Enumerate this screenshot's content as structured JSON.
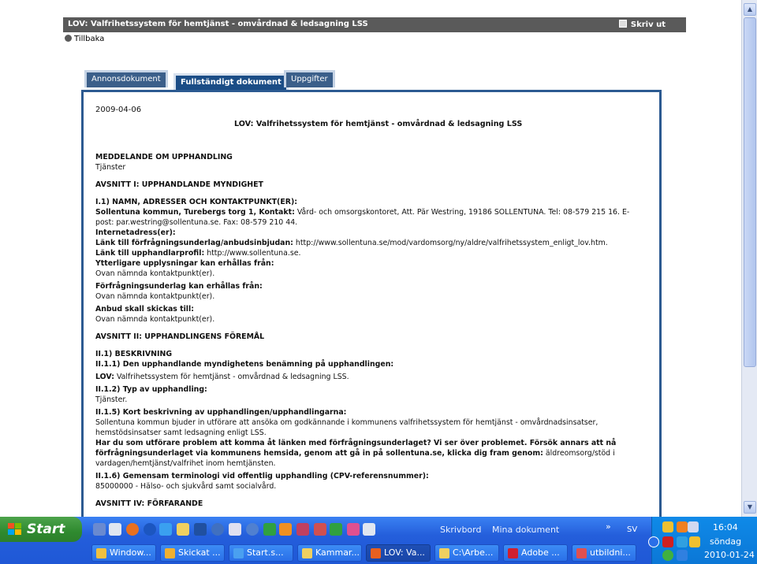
{
  "header": {
    "title": "LOV: Valfrihetssystem för hemtjänst - omvårdnad & ledsagning LSS",
    "print_label": "Skriv ut"
  },
  "back_label": "Tillbaka",
  "tabs": [
    {
      "label": "Annonsdokument"
    },
    {
      "label": "Fullständigt dokument"
    },
    {
      "label": "Uppgifter"
    }
  ],
  "document": {
    "date": "2009-04-06",
    "title": "LOV: Valfrihetssystem för hemtjänst - omvårdnad & ledsagning LSS",
    "notice_heading": "MEDDELANDE OM UPPHANDLING",
    "notice_type": "Tjänster",
    "section1_heading": "AVSNITT I: UPPHANDLANDE MYNDIGHET",
    "s1_1_heading": "I.1) NAMN, ADRESSER OCH KONTAKTPUNKT(ER):",
    "s1_1_org_bold": "Sollentuna kommun, Turebergs torg 1, Kontakt:",
    "s1_1_org_rest": "Vård- och omsorgskontoret, Att. Pär Westring, 19186 SOLLENTUNA. Tel: 08-579 215 16. E-post: par.westring@sollentuna.se. Fax: 08-579 210 44.",
    "internet_label": "Internetadress(er):",
    "link_docs_label": "Länk till förfrågningsunderlag/anbudsinbjudan:",
    "link_docs_value": "http://www.sollentuna.se/mod/vardomsorg/ny/aldre/valfrihetssystem_enligt_lov.htm.",
    "link_profile_label": "Länk till upphandlarprofil:",
    "link_profile_value": "http://www.sollentuna.se.",
    "more_info_label": "Ytterligare upplysningar kan erhållas från:",
    "more_info_value": "Ovan nämnda kontaktpunkt(er).",
    "docs_from_label": "Förfrågningsunderlag kan erhållas från:",
    "docs_from_value": "Ovan nämnda kontaktpunkt(er).",
    "submit_label": "Anbud skall skickas till:",
    "submit_value": "Ovan nämnda kontaktpunkt(er).",
    "section2_heading": "AVSNITT II: UPPHANDLINGENS FÖREMÅL",
    "s2_1_heading": "II.1) BESKRIVNING",
    "s2_1_1_heading": "II.1.1) Den upphandlande myndighetens benämning på upphandlingen:",
    "s2_1_1_bold": "LOV:",
    "s2_1_1_rest": "Valfrihetssystem för hemtjänst - omvårdnad & ledsagning LSS.",
    "s2_1_2_heading": "II.1.2) Typ av upphandling:",
    "s2_1_2_value": "Tjänster.",
    "s2_1_5_heading": "II.1.5) Kort beskrivning av upphandlingen/upphandlingarna:",
    "s2_1_5_value": "Sollentuna kommun bjuder in utförare att ansöka om godkännande i kommunens valfrihetssystem för hemtjänst - omvårdnadsinsatser, hemstödsinsatser samt ledsagning enligt LSS.",
    "s2_1_5_bold": "Har du som utförare problem att komma åt länken med förfrågningsunderlaget? Vi ser över problemet. Försök annars att nå förfrågningsunderlaget via kommunens hemsida, genom att gå in på sollentuna.se, klicka dig fram genom:",
    "s2_1_5_rest": "äldreomsorg/stöd i vardagen/hemtjänst/valfrihet inom hemtjänsten.",
    "s2_1_6_heading": "II.1.6) Gemensam terminologi vid offentlig upphandling (CPV-referensnummer):",
    "s2_1_6_value": "85000000 - Hälso- och sjukvård samt socialvård.",
    "section4_heading": "AVSNITT IV: FÖRFARANDE"
  },
  "taskbar": {
    "start_label": "Start",
    "desktop_label": "Skrivbord",
    "my_docs_label": "Mina dokument",
    "language": "SV",
    "tasks": [
      {
        "label": "Window...",
        "icon_color": "#f0c040",
        "active": false
      },
      {
        "label": "Skickat ...",
        "icon_color": "#f0b030",
        "active": false
      },
      {
        "label": "Start.s...",
        "icon_color": "#4aa0f0",
        "active": false
      },
      {
        "label": "Kammar...",
        "icon_color": "#f0d060",
        "active": false
      },
      {
        "label": "LOV: Va...",
        "icon_color": "#e86020",
        "active": true
      },
      {
        "label": "C:\\Arbe...",
        "icon_color": "#f0d060",
        "active": false
      },
      {
        "label": "Adobe ...",
        "icon_color": "#d02030",
        "active": false
      },
      {
        "label": "utbildni...",
        "icon_color": "#e05050",
        "active": false
      }
    ],
    "clock": {
      "time": "16:04",
      "day": "söndag",
      "date": "2010-01-24"
    }
  }
}
